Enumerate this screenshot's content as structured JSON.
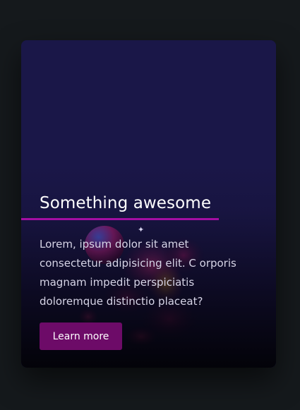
{
  "card": {
    "title": "Something awesome",
    "description": "Lorem, ipsum dolor sit amet consectetur adipisicing elit. C orporis magnam impedit perspiciatis doloremque distinctio placeat?",
    "button_label": "Learn more",
    "decoration_icon": "sparkle-icon"
  },
  "colors": {
    "page_background": "#15191c",
    "card_background": "#1a1748",
    "accent_underline": "#a40ea3",
    "button_background": "#6d0b68",
    "title_text": "#ffffff",
    "body_text": "#d6d4e6"
  }
}
